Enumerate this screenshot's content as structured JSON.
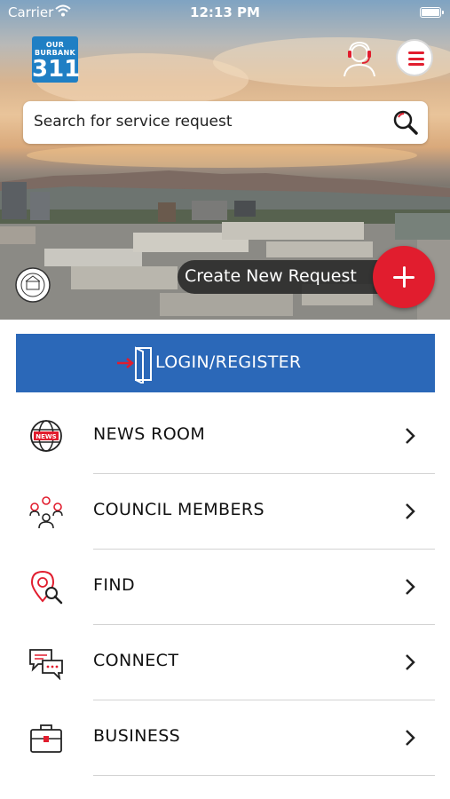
{
  "status_bar": {
    "carrier": "Carrier",
    "time": "12:13 PM"
  },
  "app": {
    "logo_small": "OUR\nBURBANK",
    "logo_number": "311"
  },
  "search": {
    "placeholder": "Search for service request"
  },
  "create_request": {
    "label": "Create New Request"
  },
  "login": {
    "label": "LOGIN/REGISTER"
  },
  "menu": [
    {
      "label": "NEWS ROOM",
      "icon": "news-globe-icon"
    },
    {
      "label": "COUNCIL MEMBERS",
      "icon": "council-members-icon"
    },
    {
      "label": "FIND",
      "icon": "find-location-icon"
    },
    {
      "label": "CONNECT",
      "icon": "chat-bubbles-icon"
    },
    {
      "label": "BUSINESS",
      "icon": "briefcase-icon"
    }
  ],
  "colors": {
    "accent_red": "#e11d2e",
    "login_blue": "#2b68b8",
    "logo_blue": "#1f7fc4"
  }
}
